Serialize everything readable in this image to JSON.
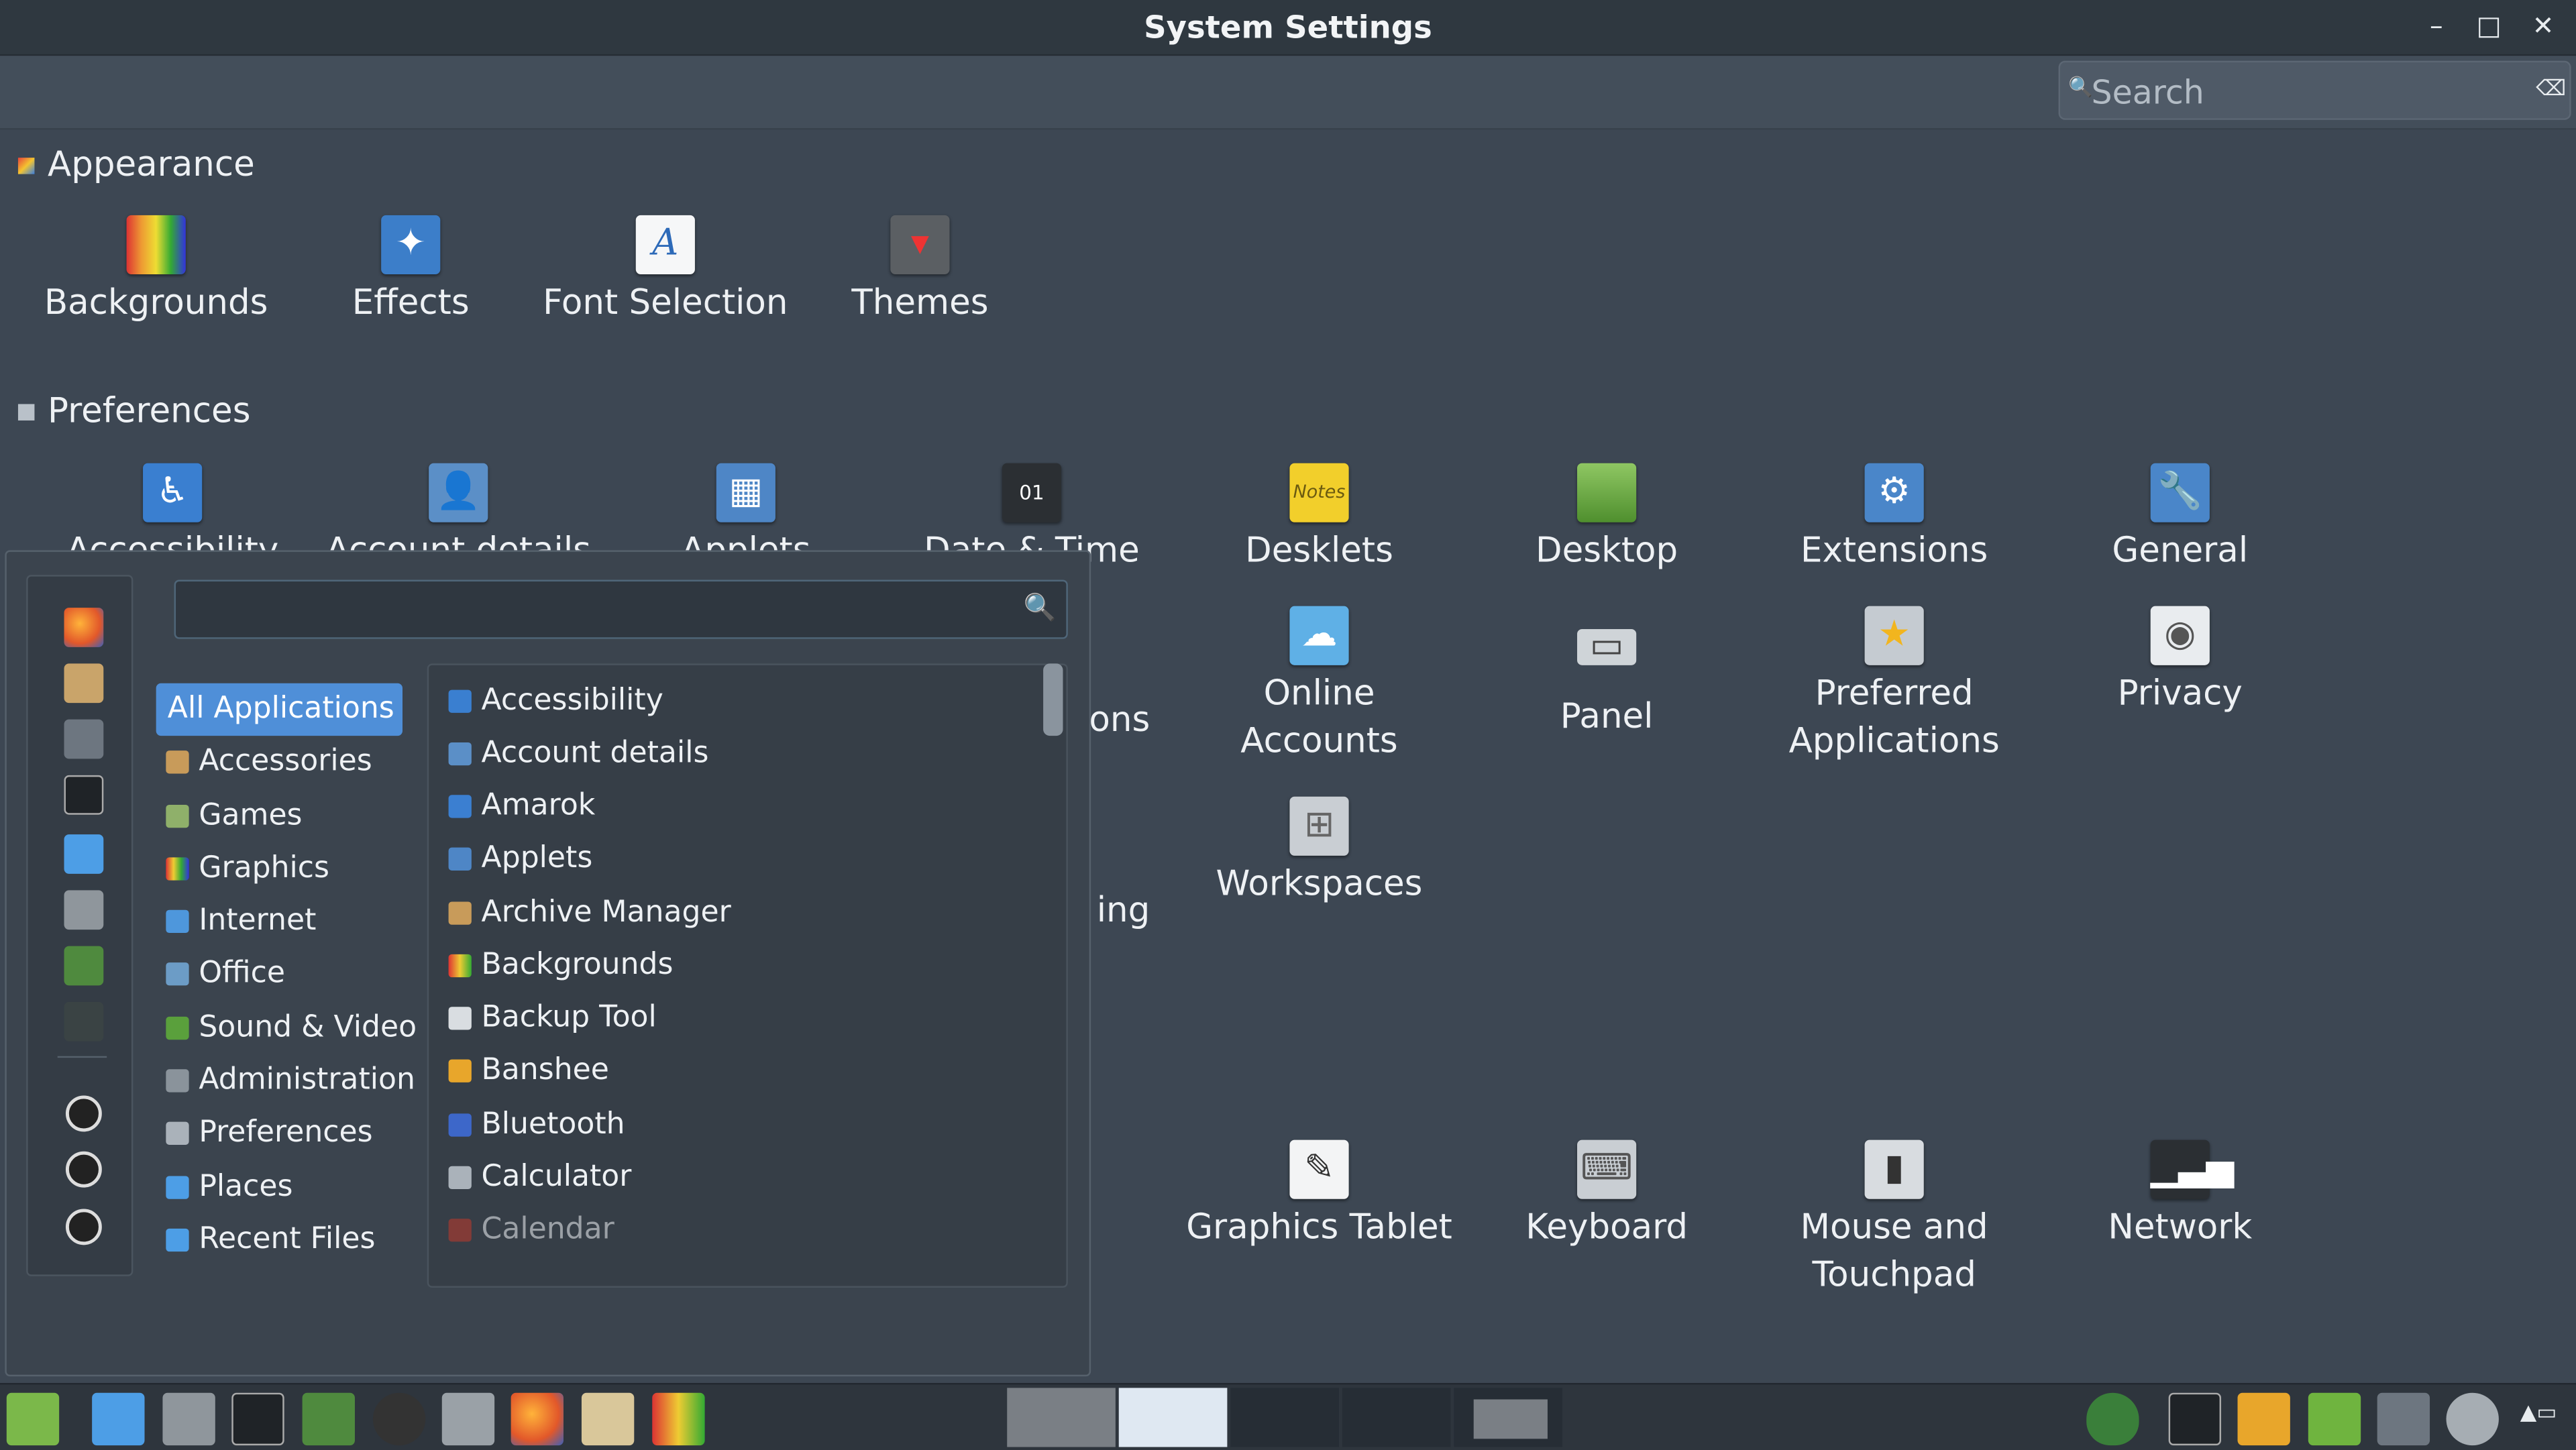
{
  "window": {
    "title": "System Settings",
    "minimize": "–",
    "maximize": "□",
    "close": "✕"
  },
  "toolbar": {
    "search_placeholder": "Search",
    "search_icon": "search-icon",
    "clear_icon": "clear-icon"
  },
  "sections": {
    "appearance": {
      "title": "Appearance",
      "items": [
        {
          "label": "Backgrounds",
          "icon": "backgrounds-icon"
        },
        {
          "label": "Effects",
          "icon": "effects-icon"
        },
        {
          "label": "Font Selection",
          "icon": "font-selection-icon"
        },
        {
          "label": "Themes",
          "icon": "themes-icon"
        }
      ]
    },
    "preferences": {
      "title": "Preferences",
      "partial_labels": [
        "Accessibility",
        "Account details",
        "Applets",
        "Date & Time",
        "ons",
        "ing"
      ],
      "row1": [
        {
          "label": "Desklets",
          "icon": "desklets-icon"
        },
        {
          "label": "Desktop",
          "icon": "desktop-icon"
        },
        {
          "label": "Extensions",
          "icon": "extensions-icon"
        },
        {
          "label": "General",
          "icon": "general-icon"
        }
      ],
      "row2": [
        {
          "label": "Online\nAccounts",
          "icon": "online-accounts-icon"
        },
        {
          "label": "Panel",
          "icon": "panel-icon"
        },
        {
          "label": "Preferred\nApplications",
          "icon": "preferred-applications-icon"
        },
        {
          "label": "Privacy",
          "icon": "privacy-icon"
        }
      ],
      "row3": [
        {
          "label": "Workspaces",
          "icon": "workspaces-icon"
        }
      ]
    },
    "hardware": {
      "items": [
        {
          "label": "Graphics Tablet",
          "icon": "graphics-tablet-icon"
        },
        {
          "label": "Keyboard",
          "icon": "keyboard-icon"
        },
        {
          "label": "Mouse and\nTouchpad",
          "icon": "mouse-icon"
        },
        {
          "label": "Network",
          "icon": "network-icon"
        }
      ]
    }
  },
  "menu": {
    "search_value": "",
    "categories": [
      "All Applications",
      "Accessories",
      "Games",
      "Graphics",
      "Internet",
      "Office",
      "Sound & Video",
      "Administration",
      "Preferences",
      "Places",
      "Recent Files"
    ],
    "applications": [
      "Accessibility",
      "Account details",
      "Amarok",
      "Applets",
      "Archive Manager",
      "Backgrounds",
      "Backup Tool",
      "Banshee",
      "Bluetooth",
      "Calculator",
      "Calendar"
    ]
  },
  "colors": {
    "accent": "#4f8fd8",
    "background": "#3d4753",
    "titlebar": "#2f3840",
    "taskbar": "#2e353d"
  }
}
